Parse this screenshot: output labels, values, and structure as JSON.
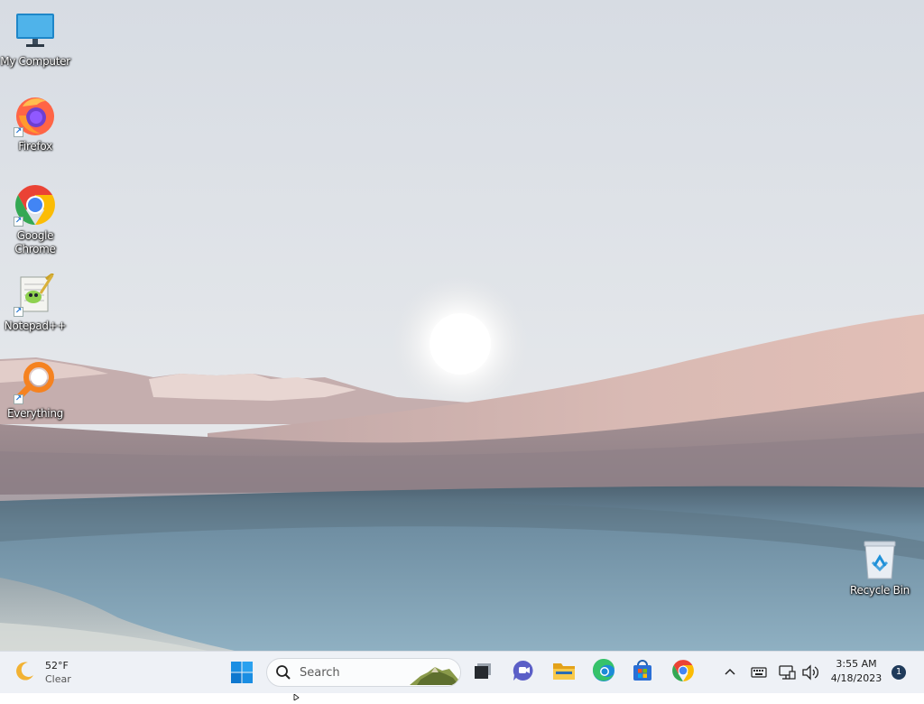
{
  "desktop": {
    "icons": [
      {
        "label": "My Computer",
        "icon": "monitor-icon"
      },
      {
        "label": "Firefox",
        "icon": "firefox-icon"
      },
      {
        "label": "Google Chrome",
        "icon": "chrome-icon"
      },
      {
        "label": "Notepad++",
        "icon": "notepadpp-icon"
      },
      {
        "label": "Everything",
        "icon": "everything-search-icon"
      },
      {
        "label": "Recycle Bin",
        "icon": "recycle-bin-icon"
      }
    ]
  },
  "taskbar": {
    "weather": {
      "temp": "52°F",
      "condition": "Clear",
      "icon": "moon-icon"
    },
    "start_icon": "windows-start-icon",
    "search": {
      "placeholder": "Search"
    },
    "apps": [
      {
        "name": "Task View",
        "icon": "task-view-icon"
      },
      {
        "name": "Chat",
        "icon": "chat-icon"
      },
      {
        "name": "File Explorer",
        "icon": "folder-icon"
      },
      {
        "name": "Microsoft Edge",
        "icon": "edge-icon"
      },
      {
        "name": "Microsoft Store",
        "icon": "store-icon"
      },
      {
        "name": "Google Chrome",
        "icon": "chrome-icon"
      }
    ],
    "tray": {
      "chevron_icon": "chevron-up-icon",
      "keyboard_icon": "keyboard-icon",
      "network_icon": "network-icon",
      "volume_icon": "volume-icon",
      "time": "3:55 AM",
      "date": "4/18/2023",
      "notification_count": "1"
    }
  },
  "colors": {
    "taskbar_bg": "#eef1f6",
    "sky_top": "#d8dde4",
    "dune": "#d8b8b3",
    "water": "#7f9fb2"
  }
}
